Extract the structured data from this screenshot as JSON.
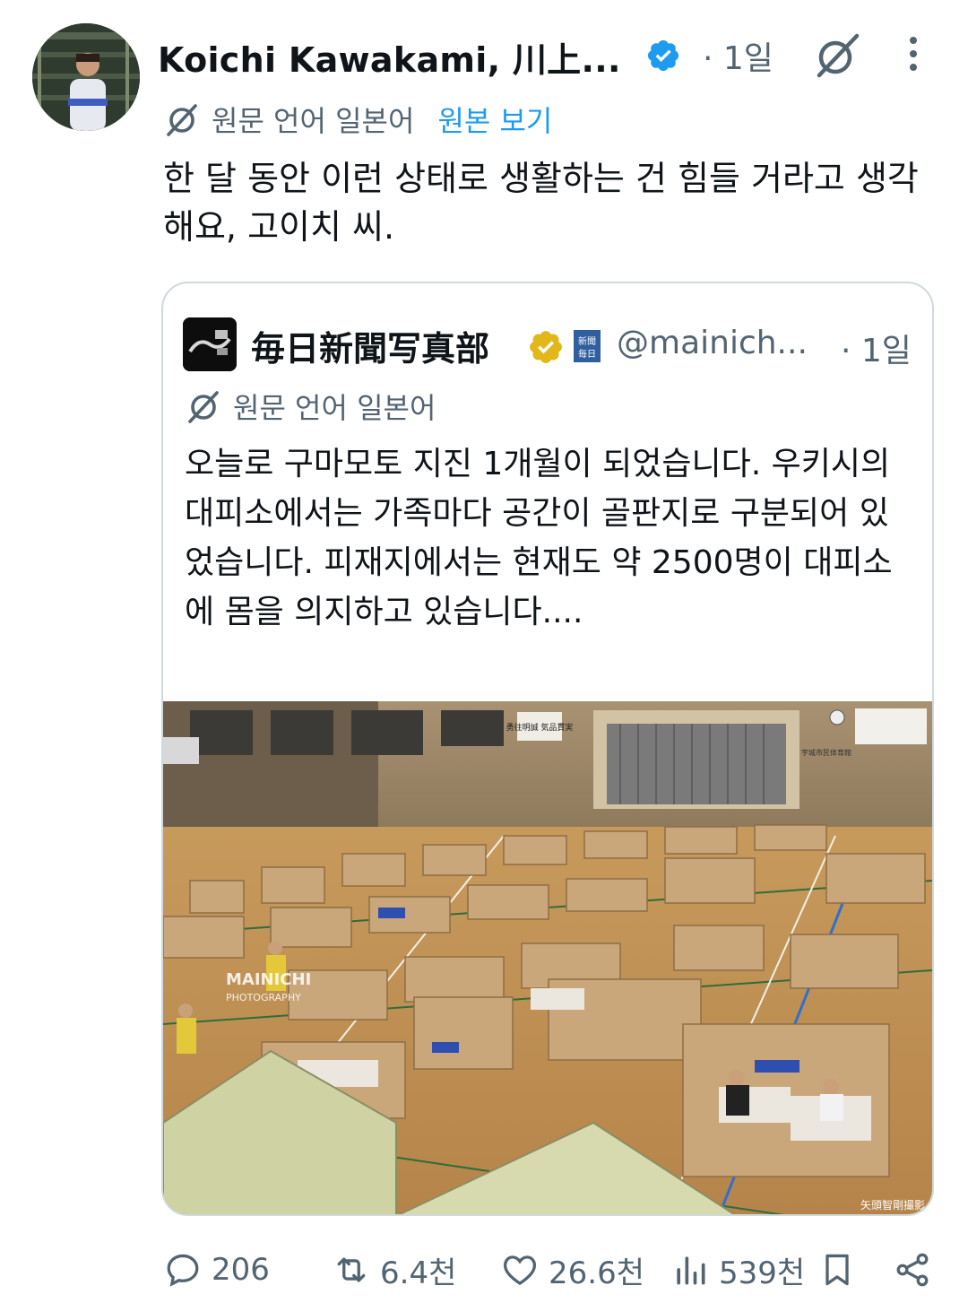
{
  "author": {
    "name": "Koichi Kawakami, 川上...",
    "time": "· 1일"
  },
  "translation": {
    "label": "원문 언어 일본어",
    "view_original": "원본 보기"
  },
  "tweet": {
    "text": "한 달 동안 이런 상태로 생활하는 건 힘들 거라고 생각해요, 고이치 씨."
  },
  "quote": {
    "name": "毎日新聞写真部",
    "affiliate_badge": "新聞 毎日",
    "handle": "@mainich...",
    "time": "· 1일",
    "translation_label": "원문 언어 일본어",
    "text": "오늘로 구마모토 지진 1개월이 되었습니다. 우키시의 대피소에서는 가족마다 공간이 골판지로 구분되어 있었습니다. 피재지에서는 현재도 약 2500명이 대피소에 몸을 의지하고 있습니다....",
    "photo": {
      "watermark": "MAINICHI",
      "watermark_sub": "PHOTOGRAPHY",
      "credit": "矢頭智剛撮影",
      "banner": "勇往明誠 気品貫実",
      "stage_label": "宇城市民体育館"
    }
  },
  "actions": {
    "replies": "206",
    "reposts": "6.4천",
    "likes": "26.6천",
    "views": "539천"
  },
  "colors": {
    "text": "#0f1419",
    "secondary": "#536471",
    "link": "#1d9bf0",
    "verified": "#1d9bf0",
    "gold": "#e2b719",
    "border": "#cfd9de"
  }
}
